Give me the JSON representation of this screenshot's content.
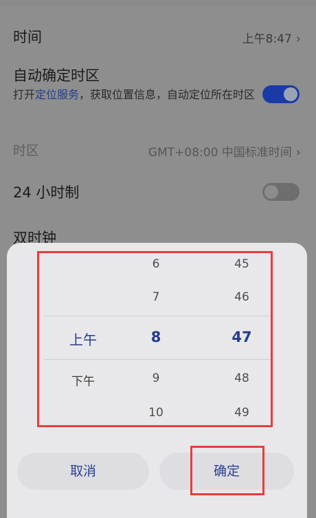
{
  "settings": {
    "time": {
      "label": "时间",
      "value": "上午8:47"
    },
    "auto_timezone": {
      "label": "自动确定时区",
      "desc_prefix": "打开",
      "desc_link": "定位服务",
      "desc_suffix": "，获取位置信息，自动定位所在时区",
      "enabled": true
    },
    "timezone": {
      "label": "时区",
      "value": "GMT+08:00 中国标准时间"
    },
    "hour24": {
      "label": "24 小时制",
      "enabled": false
    },
    "dual_clock": {
      "label": "双时钟"
    }
  },
  "picker": {
    "ampm": {
      "selected": "上午",
      "next": "下午"
    },
    "hours": [
      "6",
      "7",
      "8",
      "9",
      "10"
    ],
    "minutes": [
      "45",
      "46",
      "47",
      "48",
      "49"
    ],
    "selected_hour": "8",
    "selected_minute": "47"
  },
  "buttons": {
    "cancel": "取消",
    "confirm": "确定"
  },
  "colors": {
    "accent": "#243c8c",
    "annotation": "#e83c3c"
  }
}
